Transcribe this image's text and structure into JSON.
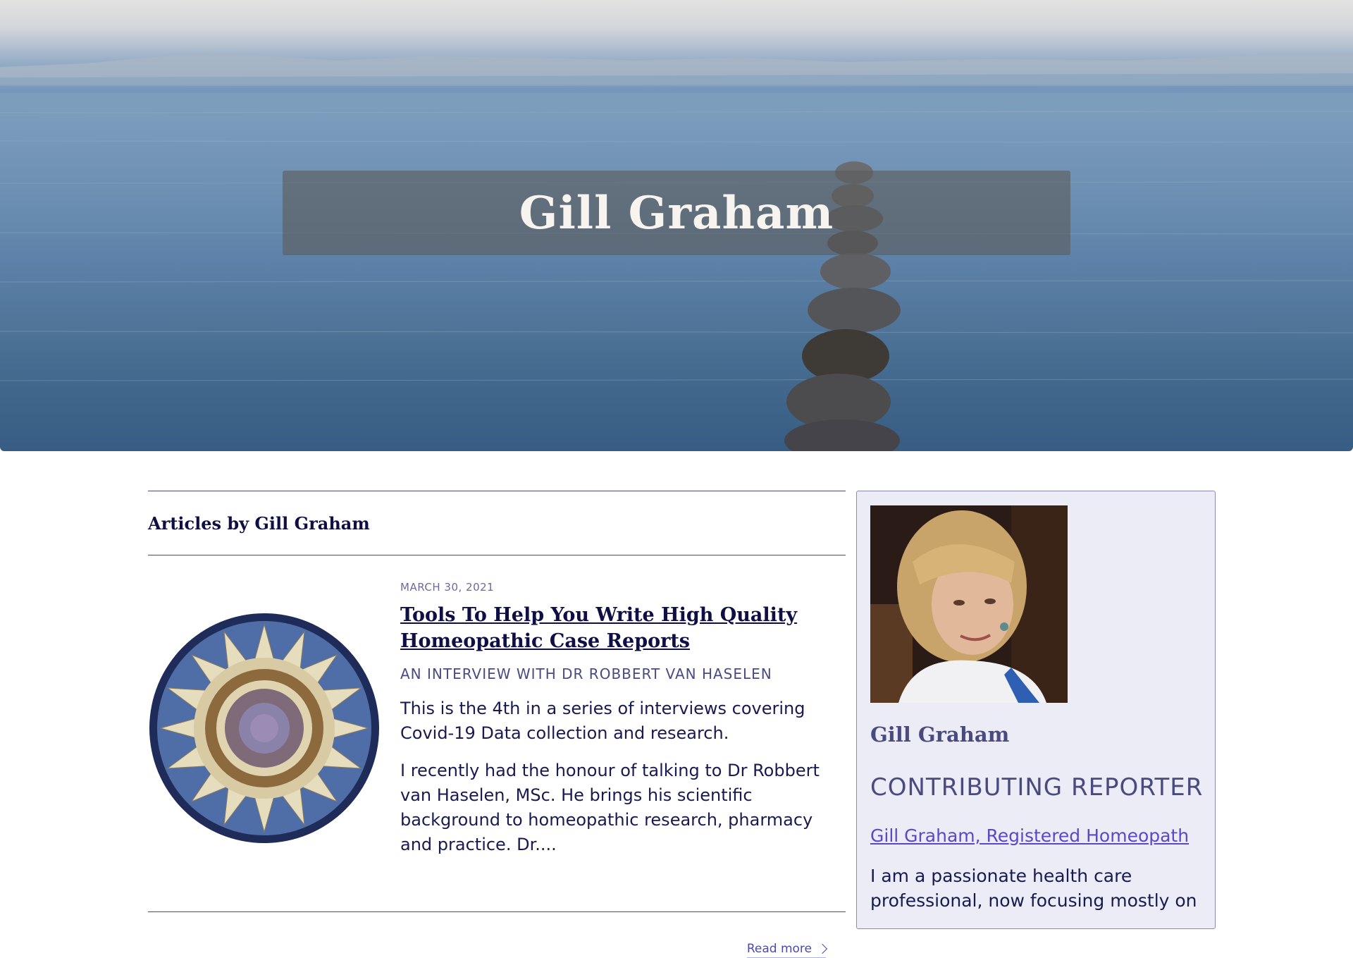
{
  "hero": {
    "title": "Gill Graham"
  },
  "main": {
    "section_title": "Articles by Gill Graham",
    "articles": [
      {
        "date": "MARCH 30, 2021",
        "title": "Tools To Help You Write High Quality Homeopathic Case Reports",
        "subtitle": "AN INTERVIEW WITH DR ROBBERT VAN HASELEN",
        "paragraphs": [
          "This is the 4th in a series of interviews covering Covid-19 Data collection and research.",
          "I recently had the honour of talking to Dr Robbert van Haselen, MSc. He brings his scientific background to homeopathic research, pharmacy and practice. Dr...."
        ],
        "read_more": "Read more"
      }
    ]
  },
  "sidebar": {
    "author_name": "Gill Graham",
    "role": "CONTRIBUTING REPORTER",
    "link": "Gill Graham, Registered Homeopath",
    "bio": "I am a passionate health care professional, now focusing mostly on"
  },
  "colors": {
    "navy": "#0f0f45",
    "muted_purple": "#4a4a80",
    "link_purple": "#5b47c9",
    "sidebar_bg": "#ececf7"
  }
}
